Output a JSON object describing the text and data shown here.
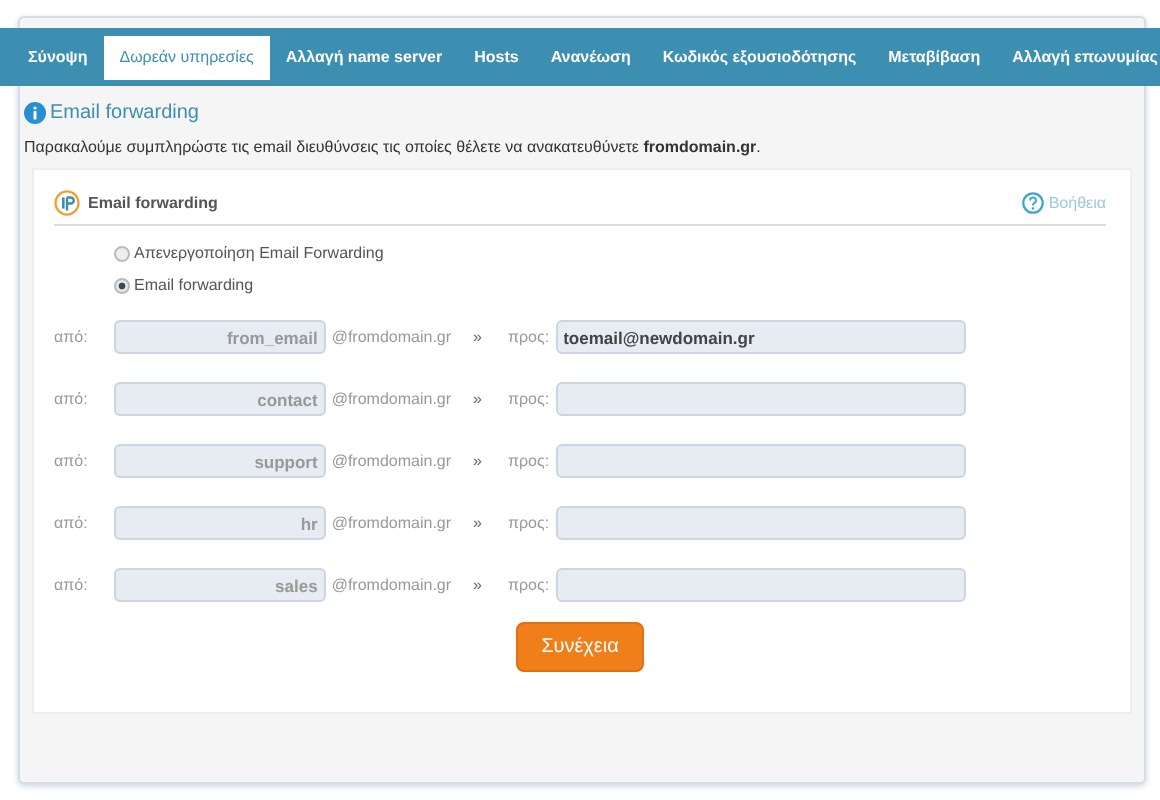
{
  "tabs": [
    {
      "label": "Σύνοψη",
      "selected": false
    },
    {
      "label": "Δωρεάν υπηρεσίες",
      "selected": true
    },
    {
      "label": "Αλλαγή name server",
      "selected": false
    },
    {
      "label": "Hosts",
      "selected": false
    },
    {
      "label": "Ανανέωση",
      "selected": false
    },
    {
      "label": "Κωδικός εξουσιοδότησης",
      "selected": false
    },
    {
      "label": "Μεταβίβαση",
      "selected": false
    },
    {
      "label": "Αλλαγή επωνυμίας",
      "selected": false
    }
  ],
  "section_title": "Email forwarding",
  "intro": "Παρακαλούμε συμπληρώστε τις email διευθύνσεις τις οποίες θέλετε να ανακατευθύνετε **fromdomain.gr**.",
  "card": {
    "title": "Email forwarding",
    "help": "Βοήθεια"
  },
  "options": [
    {
      "label": "Απενεργοποίηση Email Forwarding",
      "selected": false
    },
    {
      "label": "Email forwarding",
      "selected": true
    }
  ],
  "rows": [
    {
      "from_label": "από:",
      "from": "from_email",
      "domain": "@fromdomain.gr",
      "arrow": "»",
      "to_label": "προς:",
      "to": "toemail@newdomain.gr"
    },
    {
      "from_label": "από:",
      "from": "contact",
      "domain": "@fromdomain.gr",
      "arrow": "»",
      "to_label": "προς:",
      "to": ""
    },
    {
      "from_label": "από:",
      "from": "support",
      "domain": "@fromdomain.gr",
      "arrow": "»",
      "to_label": "προς:",
      "to": ""
    },
    {
      "from_label": "από:",
      "from": "hr",
      "domain": "@fromdomain.gr",
      "arrow": "»",
      "to_label": "προς:",
      "to": ""
    },
    {
      "from_label": "από:",
      "from": "sales",
      "domain": "@fromdomain.gr",
      "arrow": "»",
      "to_label": "προς:",
      "to": ""
    }
  ],
  "submit": "Συνέχεια"
}
